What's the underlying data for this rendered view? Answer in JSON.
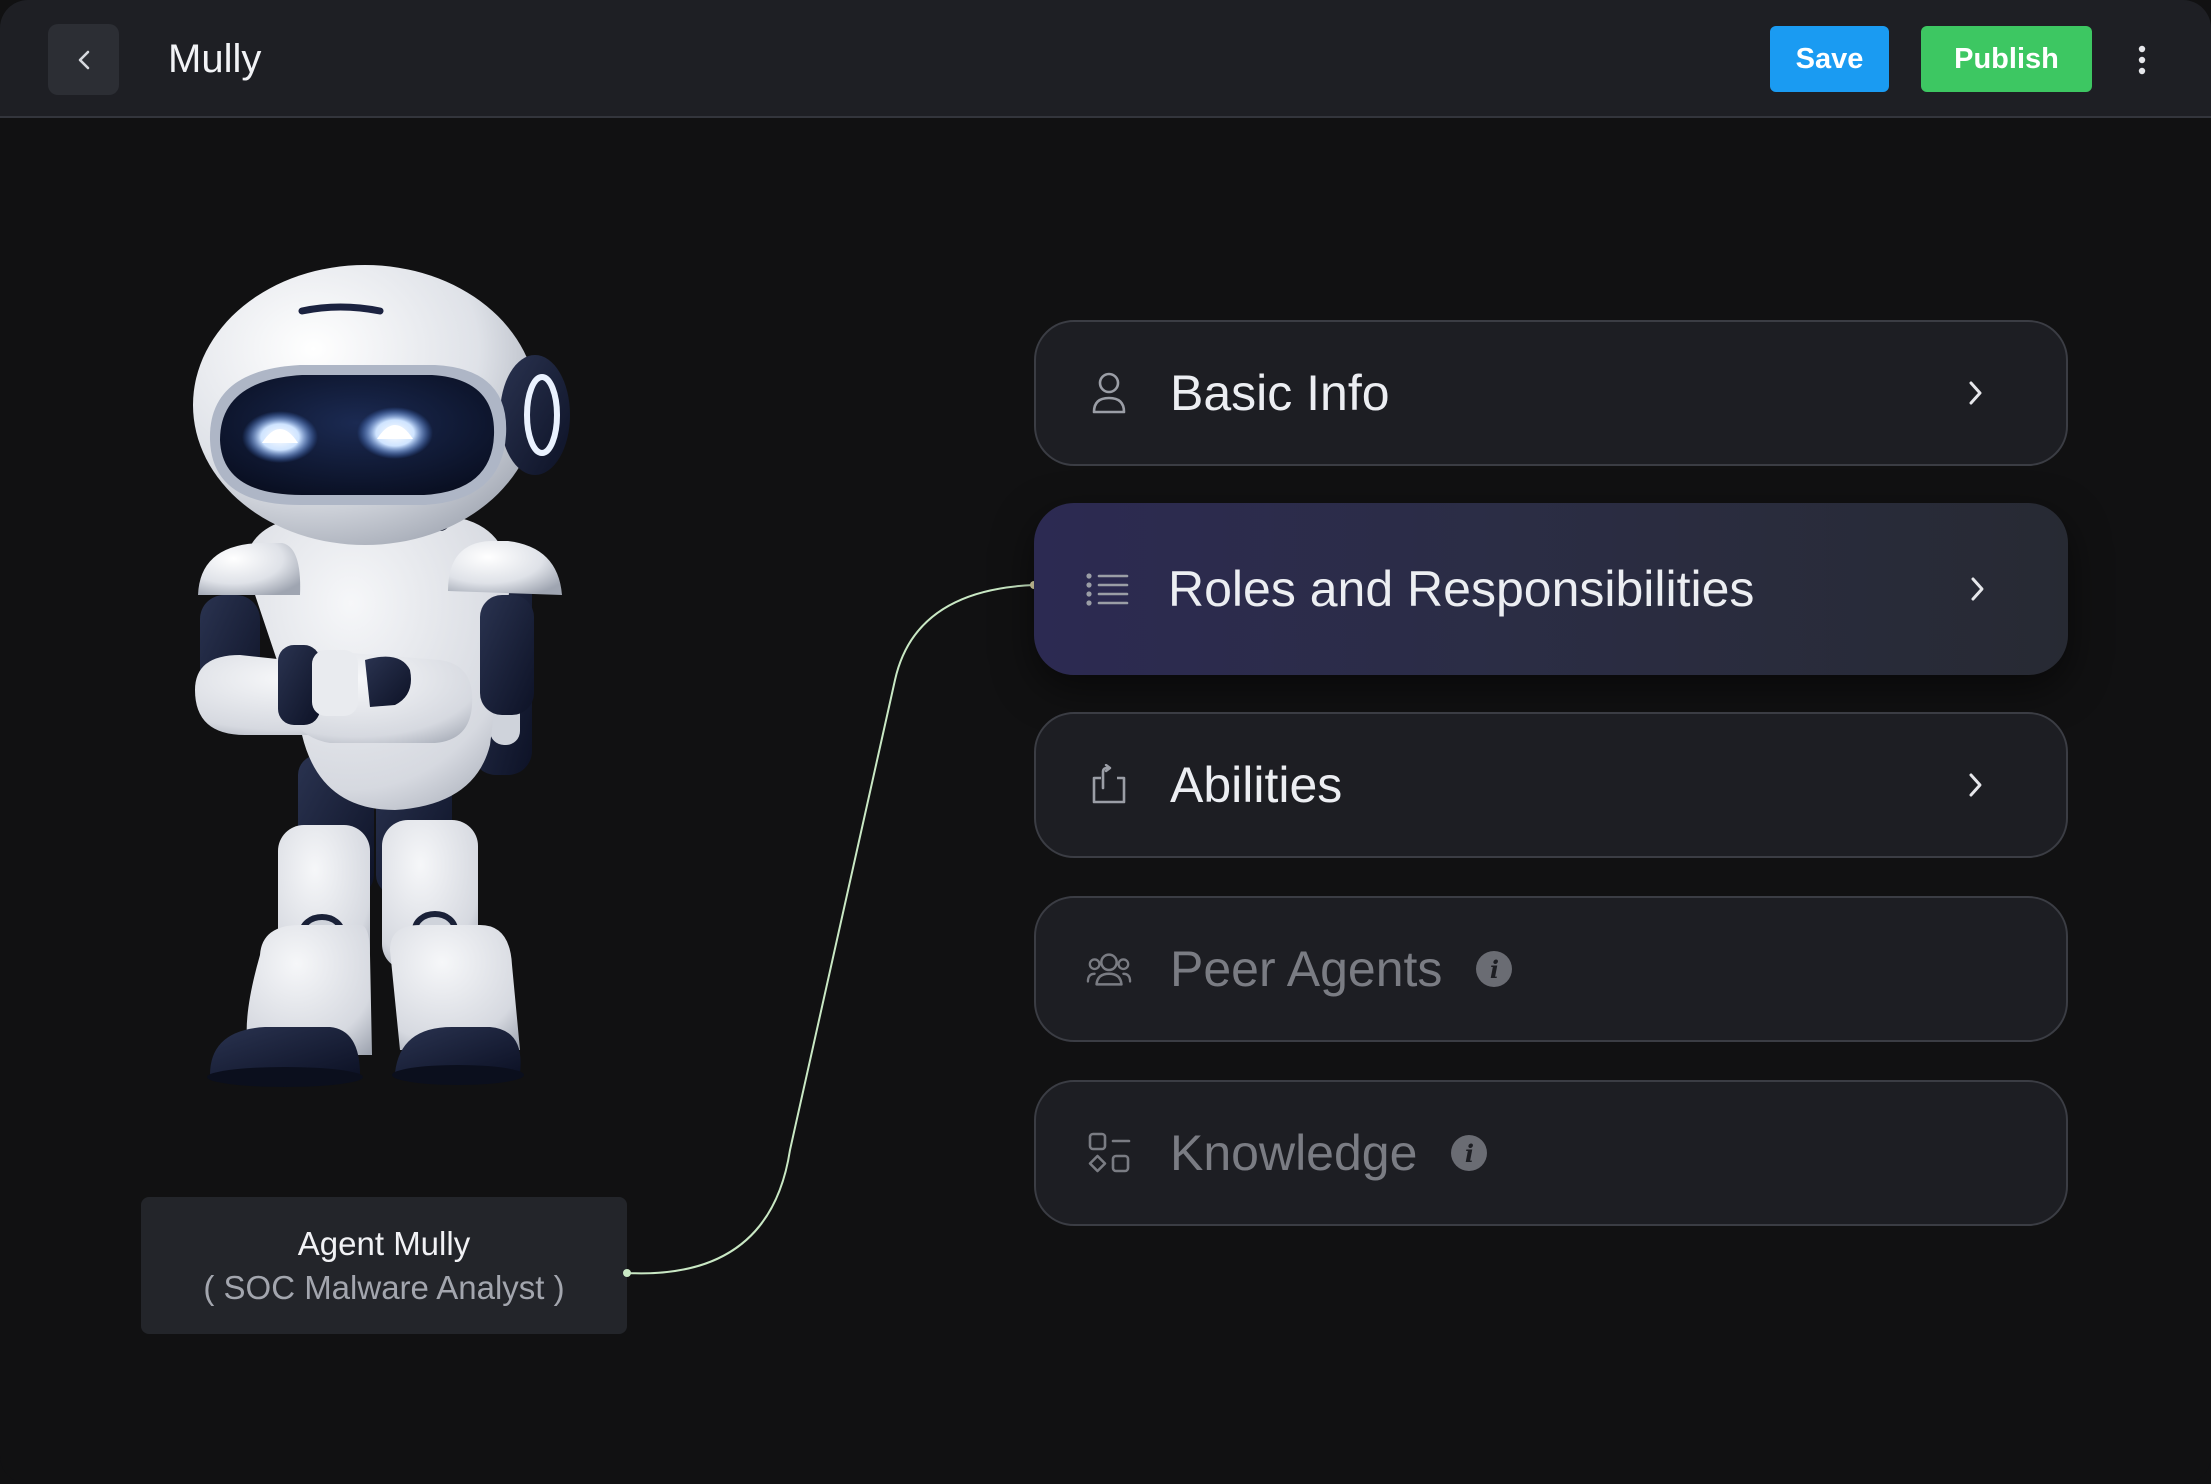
{
  "header": {
    "title": "Mully",
    "save_label": "Save",
    "publish_label": "Publish"
  },
  "agent": {
    "name": "Agent Mully",
    "role": "( SOC Malware Analyst )"
  },
  "menu": {
    "items": [
      {
        "label": "Basic Info",
        "icon": "person-icon",
        "enabled": true
      },
      {
        "label": "Roles and Responsibilities",
        "icon": "list-icon",
        "enabled": true,
        "active": true
      },
      {
        "label": "Abilities",
        "icon": "share-icon",
        "enabled": true
      },
      {
        "label": "Peer Agents",
        "icon": "group-icon",
        "enabled": false,
        "info": "i"
      },
      {
        "label": "Knowledge",
        "icon": "shapes-icon",
        "enabled": false,
        "info": "i"
      }
    ]
  },
  "colors": {
    "background": "#111112",
    "header": "#1e1f24",
    "save": "#1a9bf2",
    "publish": "#3dc762",
    "connector": "#c9e8c4"
  }
}
